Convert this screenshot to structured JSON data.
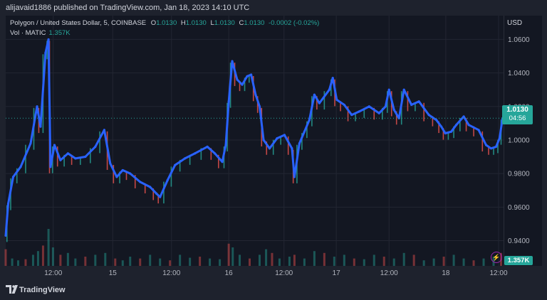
{
  "publisher": "alijavaid1886 published on TradingView.com, Jan 18, 2023 14:10 UTC",
  "legend": {
    "symbol": "Polygon / United States Dollar, 5, COINBASE",
    "o_label": "O",
    "o_value": "1.0130",
    "h_label": "H",
    "h_value": "1.0130",
    "l_label": "L",
    "l_value": "1.0130",
    "c_label": "C",
    "c_value": "1.0130",
    "change": "-0.0002 (-0.02%)",
    "vol_label": "Vol · MATIC",
    "vol_value": "1.357K"
  },
  "currency": "USD",
  "price_tag": {
    "price": "1.0130",
    "countdown": "04:56"
  },
  "volume_tag": "1.357K",
  "footer_brand": "TradingView",
  "colors": {
    "up": "#26a69a",
    "down": "#ef5350",
    "line": "#2962ff",
    "background": "#131722"
  },
  "chart_data": {
    "type": "line",
    "title": "Polygon / United States Dollar, 5, COINBASE",
    "ylabel": "USD",
    "ylim": [
      0.933,
      1.064
    ],
    "yticks": [
      "1.0600",
      "1.0400",
      "1.0200",
      "1.0000",
      "0.9800",
      "0.9600",
      "0.9400"
    ],
    "xticks": [
      "12:00",
      "15",
      "12:00",
      "16",
      "12:00",
      "17",
      "12:00",
      "18",
      "12:00"
    ],
    "xlim": [
      0,
      100
    ],
    "xtick_positions": [
      9.55,
      21.5,
      33.3,
      44.8,
      55.9,
      66.4,
      77.0,
      88.4,
      99.0
    ],
    "last_price": 1.013,
    "grid": true,
    "series": [
      {
        "name": "Polygon / United States Dollar",
        "x": [
          0,
          0.5,
          1.5,
          3,
          5,
          6.3,
          7,
          8,
          8.6,
          9,
          9.8,
          11,
          12.5,
          14,
          16,
          18,
          19.8,
          21,
          22.3,
          23.5,
          25,
          27,
          29,
          30.3,
          31,
          32.5,
          34,
          36,
          38,
          40.5,
          42,
          43.5,
          44.2,
          44.8,
          45.5,
          46.5,
          47.5,
          48.5,
          49.3,
          50.2,
          51,
          51.8,
          53,
          54.5,
          56,
          57.5,
          58,
          59,
          60,
          61,
          62,
          63,
          65,
          65.7,
          66.5,
          68,
          69.5,
          71,
          73,
          75,
          76.3,
          77,
          78,
          79,
          80,
          81.5,
          83,
          85,
          86.5,
          87.5,
          88.3,
          89.5,
          90.5,
          92,
          93,
          95,
          96.5,
          97.5,
          98.5,
          99.2,
          99.8
        ],
        "values": [
          0.943,
          0.962,
          0.978,
          0.984,
          0.998,
          1.02,
          1.008,
          1.052,
          1.06,
          0.984,
          0.997,
          0.988,
          0.992,
          0.989,
          0.99,
          0.996,
          1.006,
          0.986,
          0.978,
          0.982,
          0.98,
          0.975,
          0.972,
          0.968,
          0.966,
          0.976,
          0.985,
          0.989,
          0.992,
          0.996,
          0.992,
          0.987,
          0.997,
          1.023,
          1.047,
          1.036,
          1.033,
          1.038,
          1.039,
          1.027,
          1.02,
          1.0,
          0.995,
          1.001,
          1.003,
          0.995,
          0.978,
          0.998,
          1.005,
          1.012,
          1.027,
          1.022,
          1.03,
          1.037,
          1.024,
          1.021,
          1.015,
          1.017,
          1.02,
          1.016,
          1.02,
          1.03,
          1.018,
          1.013,
          1.03,
          1.021,
          1.023,
          1.015,
          1.012,
          1.008,
          1.004,
          1.005,
          1.009,
          1.014,
          1.009,
          1.006,
          0.997,
          0.995,
          0.996,
          1.001,
          1.013
        ]
      }
    ],
    "volume": {
      "name": "Vol · MATIC",
      "last": "1.357K",
      "x": [
        0,
        1.3,
        2.5,
        4,
        5.5,
        6.5,
        7.5,
        8.6,
        9.5,
        11,
        12.5,
        14,
        16,
        18,
        20,
        22,
        23.5,
        25,
        27,
        29,
        31,
        33,
        35,
        37,
        39,
        41,
        43,
        44.8,
        45.6,
        47,
        49,
        51,
        52.3,
        53.5,
        55,
        57,
        58,
        60,
        62,
        64,
        66,
        68,
        70,
        72,
        74,
        76,
        78,
        80,
        82,
        84,
        86,
        88,
        90,
        92,
        94,
        96,
        98,
        99.5
      ],
      "values": [
        0.45,
        0.2,
        0.15,
        0.18,
        0.3,
        0.4,
        0.55,
        1.0,
        0.5,
        0.3,
        0.35,
        0.2,
        0.25,
        0.3,
        0.35,
        0.2,
        0.15,
        0.25,
        0.2,
        0.3,
        0.2,
        0.15,
        0.3,
        0.22,
        0.25,
        0.2,
        0.18,
        0.6,
        0.5,
        0.3,
        0.2,
        0.3,
        0.45,
        0.35,
        0.2,
        0.25,
        0.3,
        0.2,
        0.4,
        0.35,
        0.25,
        0.3,
        0.2,
        0.18,
        0.3,
        0.25,
        0.2,
        0.35,
        0.3,
        0.15,
        0.2,
        0.25,
        0.3,
        0.2,
        0.15,
        0.2,
        0.25,
        0.35
      ]
    }
  }
}
